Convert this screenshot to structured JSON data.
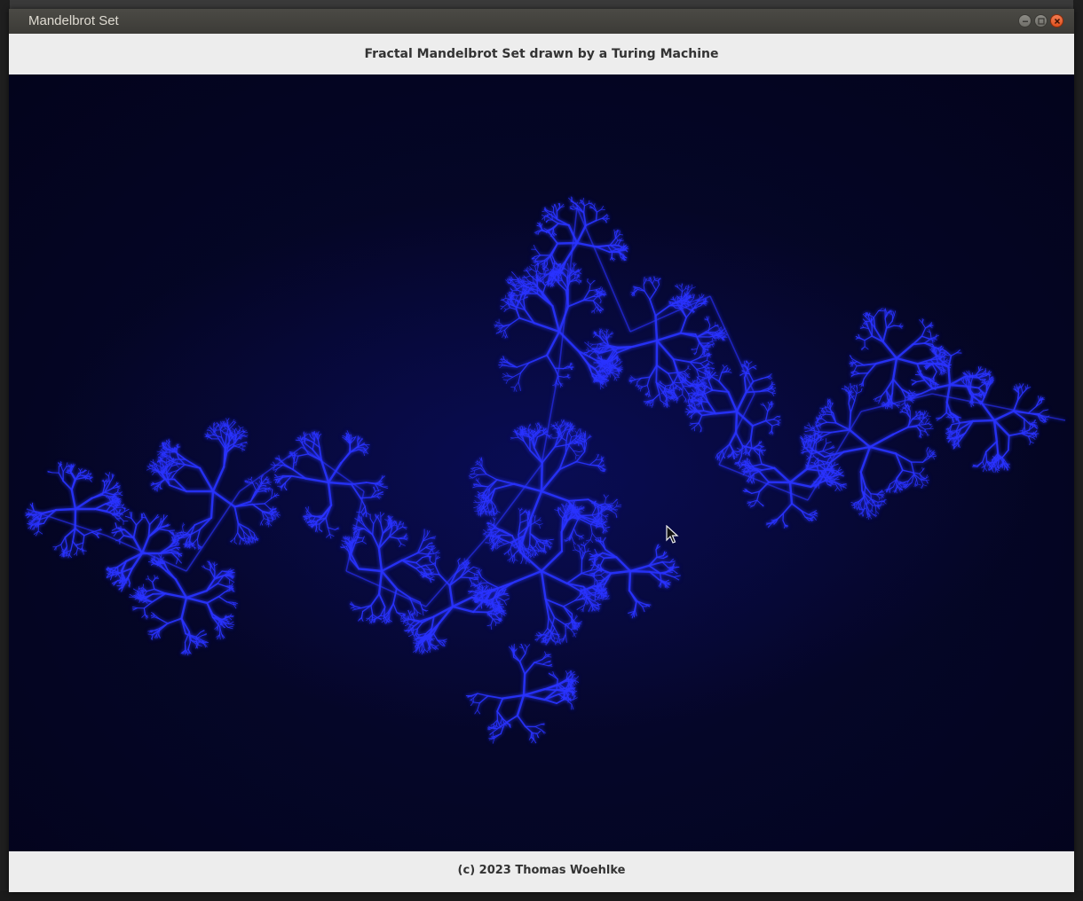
{
  "window": {
    "title": "Mandelbrot Set",
    "controls": [
      "minimize",
      "maximize",
      "close"
    ]
  },
  "header": {
    "label": "Fractal Mandelbrot Set drawn by a Turing Machine"
  },
  "canvas": {
    "description_icon": "julia-fractal",
    "colors": {
      "background": "#04052a",
      "fractal": "#2a33ff"
    }
  },
  "footer": {
    "label": "(c) 2023 Thomas Woehlke"
  }
}
